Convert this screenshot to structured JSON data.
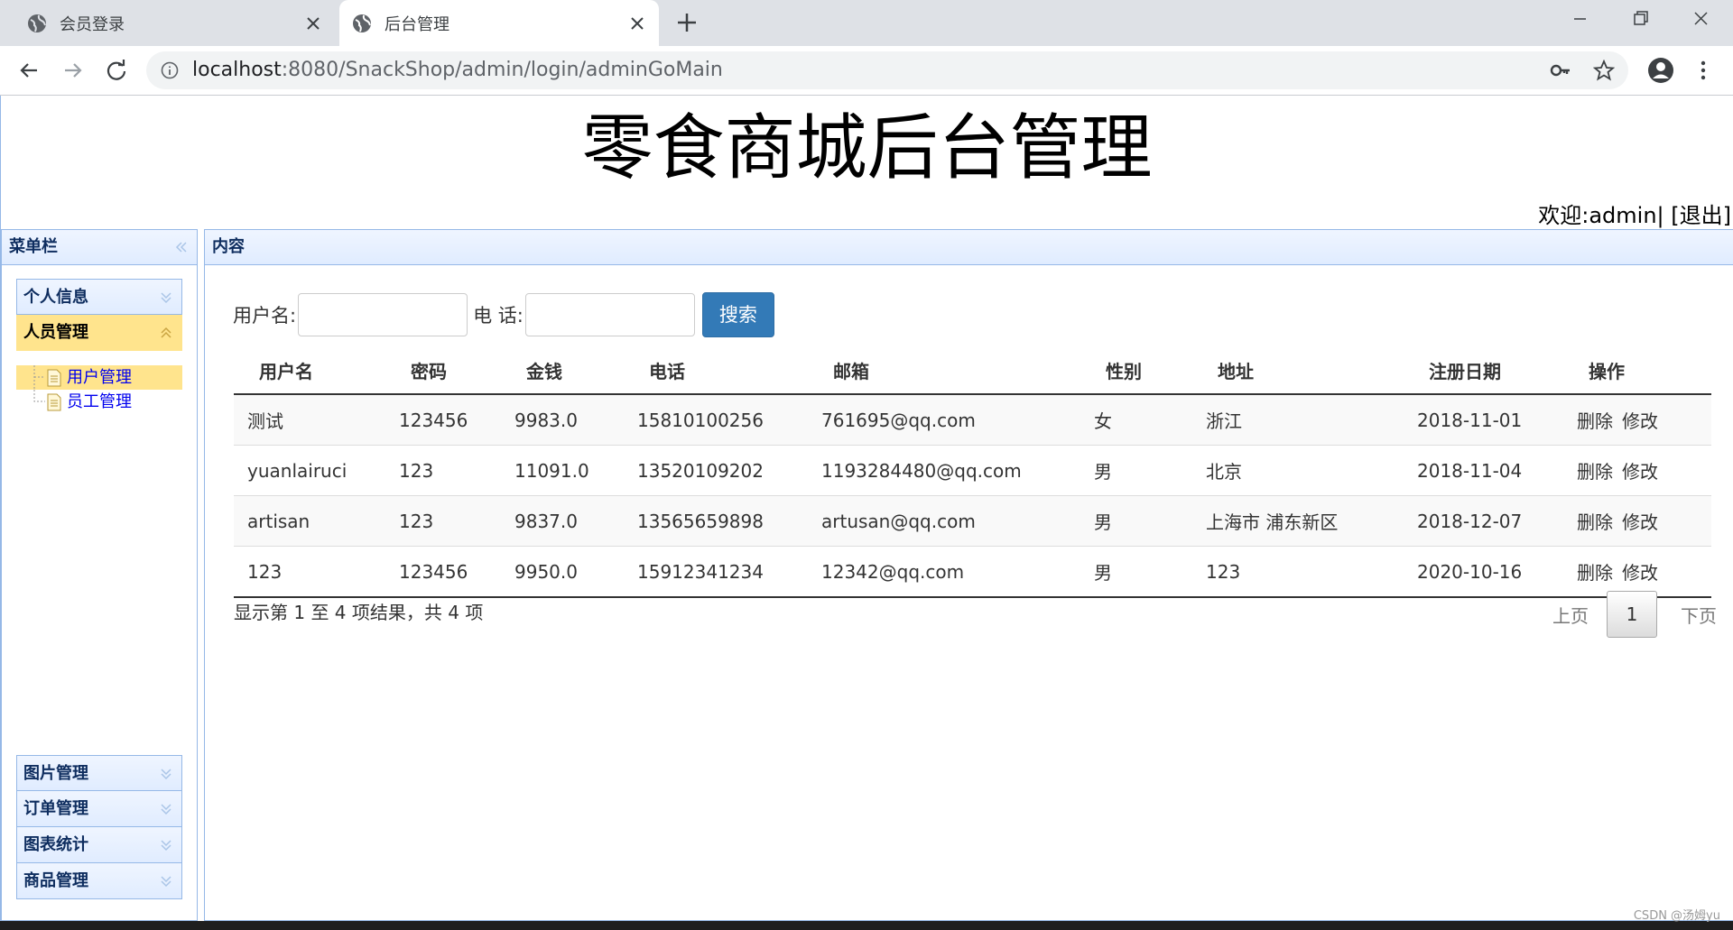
{
  "browser": {
    "tabs": [
      {
        "title": "会员登录"
      },
      {
        "title": "后台管理"
      }
    ],
    "url_host": "localhost",
    "url_rest": ":8080/SnackShop/admin/login/adminGoMain"
  },
  "header": {
    "title": "零食商城后台管理",
    "welcome": "欢迎:admin| [退出]"
  },
  "west": {
    "title": "菜单栏",
    "top_items": [
      {
        "label": "个人信息"
      },
      {
        "label": "人员管理"
      }
    ],
    "tree": [
      {
        "label": "用户管理"
      },
      {
        "label": "员工管理"
      }
    ],
    "bottom_items": [
      {
        "label": "图片管理"
      },
      {
        "label": "订单管理"
      },
      {
        "label": "图表统计"
      },
      {
        "label": "商品管理"
      }
    ]
  },
  "center": {
    "title": "内容",
    "search": {
      "username_label": "用户名:",
      "phone_label": "电 话:",
      "button": "搜索"
    },
    "table": {
      "headers": [
        "用户名",
        "密码",
        "金钱",
        "电话",
        "邮箱",
        "性别",
        "地址",
        "注册日期",
        "操作"
      ],
      "rows": [
        [
          "测试",
          "123456",
          "9983.0",
          "15810100256",
          "761695@qq.com",
          "女",
          "浙江",
          "2018-11-01"
        ],
        [
          "yuanlairuci",
          "123",
          "11091.0",
          "13520109202",
          "1193284480@qq.com",
          "男",
          "北京",
          "2018-11-04"
        ],
        [
          "artisan",
          "123",
          "9837.0",
          "13565659898",
          "artusan@qq.com",
          "男",
          "上海市 浦东新区",
          "2018-12-07"
        ],
        [
          "123",
          "123456",
          "9950.0",
          "15912341234",
          "12342@qq.com",
          "男",
          "123",
          "2020-10-16"
        ]
      ],
      "op_delete": "删除",
      "op_edit": "修改"
    },
    "info": "显示第 1 至 4 项结果，共 4 项",
    "pager": {
      "prev": "上页",
      "current": "1",
      "next": "下页"
    }
  },
  "watermark": "CSDN @汤姆yu"
}
